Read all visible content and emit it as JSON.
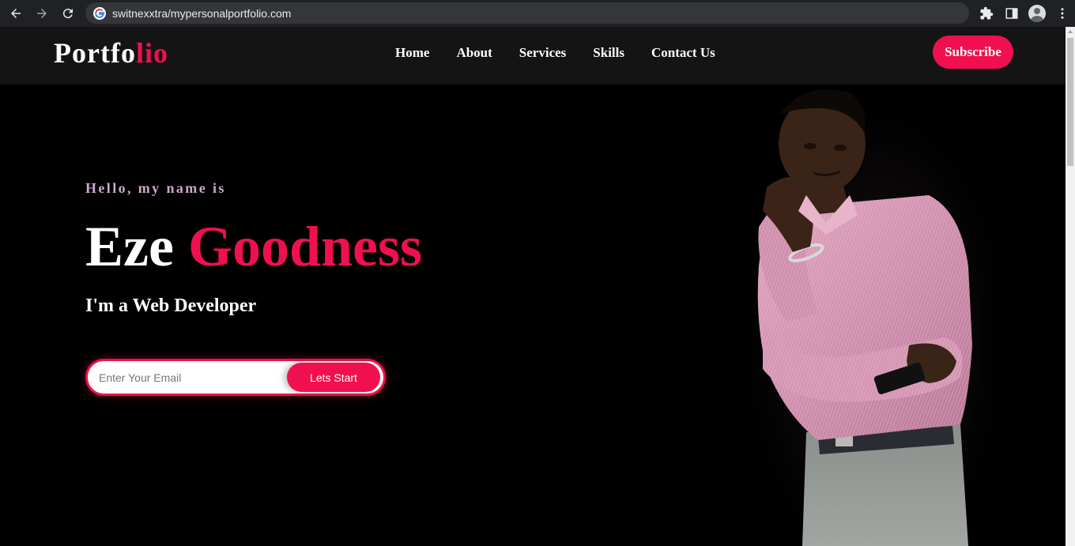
{
  "browser": {
    "url": "switnexxtra/mypersonalportfolio.com"
  },
  "header": {
    "logo_main": "Portfo",
    "logo_accent": "lio",
    "nav": [
      {
        "label": "Home"
      },
      {
        "label": "About"
      },
      {
        "label": "Services"
      },
      {
        "label": "Skills"
      },
      {
        "label": "Contact Us"
      }
    ],
    "subscribe_label": "Subscribe"
  },
  "hero": {
    "greeting": "Hello, my name is",
    "first_name": "Eze",
    "last_name": "Goodness",
    "role": "I'm a Web Developer",
    "email_placeholder": "Enter Your Email",
    "start_label": "Lets Start"
  },
  "colors": {
    "accent": "#f0104f",
    "header_bg": "#141414",
    "page_bg": "#000000",
    "greeting": "#cfa6cf"
  }
}
